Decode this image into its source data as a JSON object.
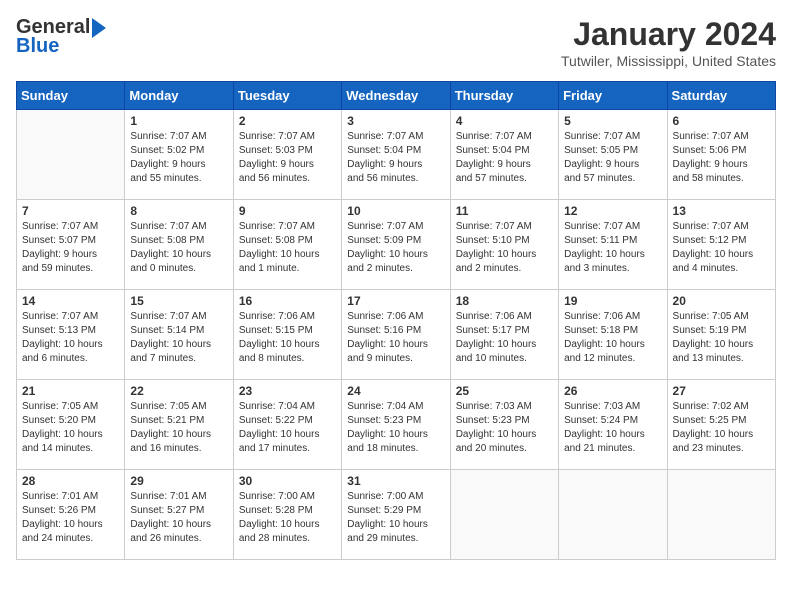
{
  "header": {
    "logo_general": "General",
    "logo_blue": "Blue",
    "title": "January 2024",
    "location": "Tutwiler, Mississippi, United States"
  },
  "days_of_week": [
    "Sunday",
    "Monday",
    "Tuesday",
    "Wednesday",
    "Thursday",
    "Friday",
    "Saturday"
  ],
  "weeks": [
    [
      {
        "day": "",
        "info": ""
      },
      {
        "day": "1",
        "info": "Sunrise: 7:07 AM\nSunset: 5:02 PM\nDaylight: 9 hours\nand 55 minutes."
      },
      {
        "day": "2",
        "info": "Sunrise: 7:07 AM\nSunset: 5:03 PM\nDaylight: 9 hours\nand 56 minutes."
      },
      {
        "day": "3",
        "info": "Sunrise: 7:07 AM\nSunset: 5:04 PM\nDaylight: 9 hours\nand 56 minutes."
      },
      {
        "day": "4",
        "info": "Sunrise: 7:07 AM\nSunset: 5:04 PM\nDaylight: 9 hours\nand 57 minutes."
      },
      {
        "day": "5",
        "info": "Sunrise: 7:07 AM\nSunset: 5:05 PM\nDaylight: 9 hours\nand 57 minutes."
      },
      {
        "day": "6",
        "info": "Sunrise: 7:07 AM\nSunset: 5:06 PM\nDaylight: 9 hours\nand 58 minutes."
      }
    ],
    [
      {
        "day": "7",
        "info": "Sunrise: 7:07 AM\nSunset: 5:07 PM\nDaylight: 9 hours\nand 59 minutes."
      },
      {
        "day": "8",
        "info": "Sunrise: 7:07 AM\nSunset: 5:08 PM\nDaylight: 10 hours\nand 0 minutes."
      },
      {
        "day": "9",
        "info": "Sunrise: 7:07 AM\nSunset: 5:08 PM\nDaylight: 10 hours\nand 1 minute."
      },
      {
        "day": "10",
        "info": "Sunrise: 7:07 AM\nSunset: 5:09 PM\nDaylight: 10 hours\nand 2 minutes."
      },
      {
        "day": "11",
        "info": "Sunrise: 7:07 AM\nSunset: 5:10 PM\nDaylight: 10 hours\nand 2 minutes."
      },
      {
        "day": "12",
        "info": "Sunrise: 7:07 AM\nSunset: 5:11 PM\nDaylight: 10 hours\nand 3 minutes."
      },
      {
        "day": "13",
        "info": "Sunrise: 7:07 AM\nSunset: 5:12 PM\nDaylight: 10 hours\nand 4 minutes."
      }
    ],
    [
      {
        "day": "14",
        "info": "Sunrise: 7:07 AM\nSunset: 5:13 PM\nDaylight: 10 hours\nand 6 minutes."
      },
      {
        "day": "15",
        "info": "Sunrise: 7:07 AM\nSunset: 5:14 PM\nDaylight: 10 hours\nand 7 minutes."
      },
      {
        "day": "16",
        "info": "Sunrise: 7:06 AM\nSunset: 5:15 PM\nDaylight: 10 hours\nand 8 minutes."
      },
      {
        "day": "17",
        "info": "Sunrise: 7:06 AM\nSunset: 5:16 PM\nDaylight: 10 hours\nand 9 minutes."
      },
      {
        "day": "18",
        "info": "Sunrise: 7:06 AM\nSunset: 5:17 PM\nDaylight: 10 hours\nand 10 minutes."
      },
      {
        "day": "19",
        "info": "Sunrise: 7:06 AM\nSunset: 5:18 PM\nDaylight: 10 hours\nand 12 minutes."
      },
      {
        "day": "20",
        "info": "Sunrise: 7:05 AM\nSunset: 5:19 PM\nDaylight: 10 hours\nand 13 minutes."
      }
    ],
    [
      {
        "day": "21",
        "info": "Sunrise: 7:05 AM\nSunset: 5:20 PM\nDaylight: 10 hours\nand 14 minutes."
      },
      {
        "day": "22",
        "info": "Sunrise: 7:05 AM\nSunset: 5:21 PM\nDaylight: 10 hours\nand 16 minutes."
      },
      {
        "day": "23",
        "info": "Sunrise: 7:04 AM\nSunset: 5:22 PM\nDaylight: 10 hours\nand 17 minutes."
      },
      {
        "day": "24",
        "info": "Sunrise: 7:04 AM\nSunset: 5:23 PM\nDaylight: 10 hours\nand 18 minutes."
      },
      {
        "day": "25",
        "info": "Sunrise: 7:03 AM\nSunset: 5:23 PM\nDaylight: 10 hours\nand 20 minutes."
      },
      {
        "day": "26",
        "info": "Sunrise: 7:03 AM\nSunset: 5:24 PM\nDaylight: 10 hours\nand 21 minutes."
      },
      {
        "day": "27",
        "info": "Sunrise: 7:02 AM\nSunset: 5:25 PM\nDaylight: 10 hours\nand 23 minutes."
      }
    ],
    [
      {
        "day": "28",
        "info": "Sunrise: 7:01 AM\nSunset: 5:26 PM\nDaylight: 10 hours\nand 24 minutes."
      },
      {
        "day": "29",
        "info": "Sunrise: 7:01 AM\nSunset: 5:27 PM\nDaylight: 10 hours\nand 26 minutes."
      },
      {
        "day": "30",
        "info": "Sunrise: 7:00 AM\nSunset: 5:28 PM\nDaylight: 10 hours\nand 28 minutes."
      },
      {
        "day": "31",
        "info": "Sunrise: 7:00 AM\nSunset: 5:29 PM\nDaylight: 10 hours\nand 29 minutes."
      },
      {
        "day": "",
        "info": ""
      },
      {
        "day": "",
        "info": ""
      },
      {
        "day": "",
        "info": ""
      }
    ]
  ]
}
